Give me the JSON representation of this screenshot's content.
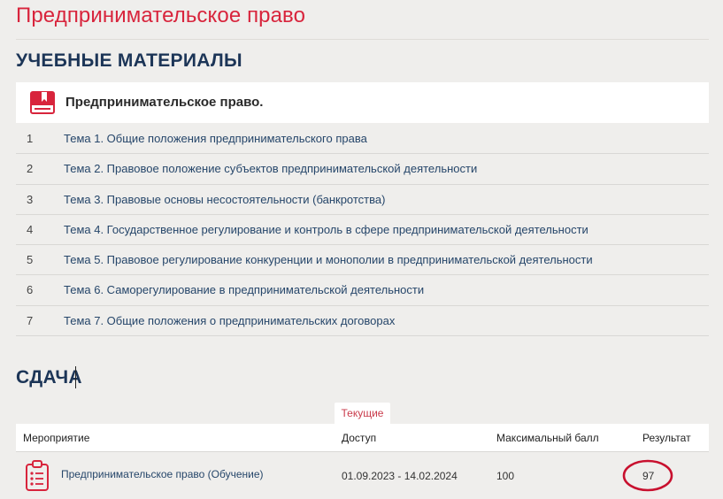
{
  "page": {
    "title": "Предпринимательское право"
  },
  "materials": {
    "heading": "УЧЕБНЫЕ МАТЕРИАЛЫ",
    "course_title": "Предпринимательское право.",
    "course_icon": "book-icon",
    "topics": [
      {
        "num": "1",
        "label": "Тема 1. Общие положения предпринимательского права"
      },
      {
        "num": "2",
        "label": "Тема 2. Правовое положение субъектов предпринимательской деятельности"
      },
      {
        "num": "3",
        "label": "Тема 3. Правовые основы несостоятельности (банкротства)"
      },
      {
        "num": "4",
        "label": "Тема 4. Государственное регулирование и контроль в сфере предпринимательской деятельности"
      },
      {
        "num": "5",
        "label": "Тема 5. Правовое регулирование конкуренции и монополии в предпринимательской деятельности"
      },
      {
        "num": "6",
        "label": "Тема 6. Саморегулирование в предпринимательской деятельности"
      },
      {
        "num": "7",
        "label": "Тема 7. Общие положения о предпринимательских договорах"
      }
    ]
  },
  "submission": {
    "heading": "СДАЧА",
    "tab_current": "Текущие",
    "columns": {
      "event": "Мероприятие",
      "access": "Доступ",
      "max_score": "Максимальный балл",
      "result": "Результат"
    },
    "rows": [
      {
        "icon": "clipboard-icon",
        "event": "Предпринимательское право (Обучение)",
        "access": "01.09.2023 - 14.02.2024",
        "max_score": "100",
        "result": "97"
      }
    ]
  },
  "colors": {
    "accent_red": "#d8243c",
    "heading_navy": "#1c3557",
    "link_blue": "#26466a",
    "background": "#efeeec"
  }
}
